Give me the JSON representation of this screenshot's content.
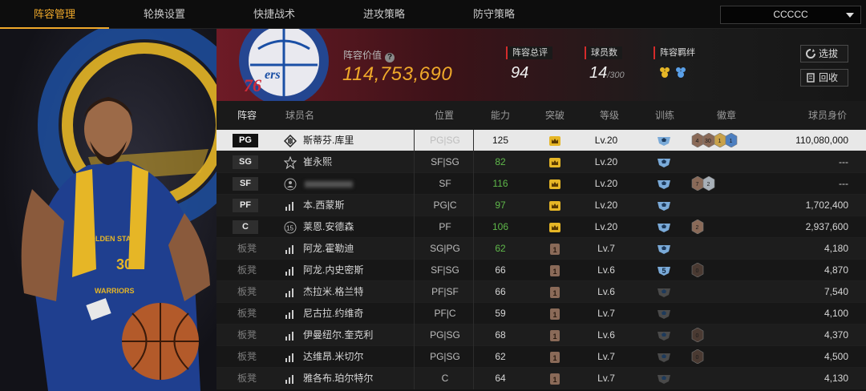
{
  "nav": {
    "tabs": [
      "阵容管理",
      "轮换设置",
      "快捷战术",
      "进攻策略",
      "防守策略"
    ],
    "active_tab": 0,
    "dropdown_value": "CCCCC"
  },
  "header": {
    "team_logo_text": "PHILADELPHIA 76ers",
    "value_label": "阵容价值",
    "value": "114,753,690",
    "rating_label": "阵容总评",
    "rating": "94",
    "count_label": "球员数",
    "count": "14",
    "count_max": "/300",
    "bond_label": "阵容羁绊",
    "btn_pick": "选拔",
    "btn_recycle": "回收"
  },
  "columns": {
    "lineup": "阵容",
    "name": "球员名",
    "position": "位置",
    "ability": "能力",
    "breakthrough": "突破",
    "level": "等级",
    "training": "训练",
    "badges": "徽章",
    "value": "球员身价"
  },
  "rows": [
    {
      "slot": "PG",
      "starter": true,
      "name": "斯蒂芬.库里",
      "pos": "PG|SG",
      "ability": "125",
      "ability_green": false,
      "break": "gold",
      "level": "Lv.20",
      "train": "blue",
      "train_num": "",
      "badges": [
        [
          "4",
          "bronze"
        ],
        [
          "30",
          "bronze"
        ],
        [
          "1",
          "gold"
        ],
        [
          "1",
          "blue"
        ]
      ],
      "value": "110,080,000",
      "pos_icon": "diamond"
    },
    {
      "slot": "SG",
      "starter": true,
      "name": "崔永熙",
      "pos": "SF|SG",
      "ability": "82",
      "ability_green": true,
      "break": "gold",
      "level": "Lv.20",
      "train": "blue",
      "train_num": "",
      "badges": [],
      "value": "---",
      "pos_icon": "star"
    },
    {
      "slot": "SF",
      "starter": true,
      "name": "",
      "pos": "SF",
      "ability": "116",
      "ability_green": true,
      "break": "gold",
      "level": "Lv.20",
      "train": "blue",
      "train_num": "",
      "badges": [
        [
          "7",
          "bronze"
        ],
        [
          "2",
          "silver"
        ]
      ],
      "value": "---",
      "pos_icon": "person"
    },
    {
      "slot": "PF",
      "starter": true,
      "name": "本.西蒙斯",
      "pos": "PG|C",
      "ability": "97",
      "ability_green": true,
      "break": "gold",
      "level": "Lv.20",
      "train": "blue",
      "train_num": "",
      "badges": [],
      "value": "1,702,400",
      "pos_icon": "bars"
    },
    {
      "slot": "C",
      "starter": true,
      "name": "莱恩.安德森",
      "pos": "PF",
      "ability": "106",
      "ability_green": true,
      "break": "gold",
      "level": "Lv.20",
      "train": "blue",
      "train_num": "",
      "badges": [
        [
          "2",
          "bronze"
        ]
      ],
      "value": "2,937,600",
      "pos_icon": "15"
    },
    {
      "slot": "板凳",
      "starter": false,
      "name": "阿龙.霍勒迪",
      "pos": "SG|PG",
      "ability": "62",
      "ability_green": true,
      "break": "1",
      "level": "Lv.7",
      "train": "blue",
      "train_num": "",
      "badges": [],
      "value": "4,180",
      "pos_icon": "bars"
    },
    {
      "slot": "板凳",
      "starter": false,
      "name": "阿龙.内史密斯",
      "pos": "SF|SG",
      "ability": "66",
      "ability_green": false,
      "break": "1",
      "level": "Lv.6",
      "train": "blue",
      "train_num": "5",
      "badges": [
        [
          "0",
          "dark"
        ]
      ],
      "value": "4,870",
      "pos_icon": "bars"
    },
    {
      "slot": "板凳",
      "starter": false,
      "name": "杰拉米.格兰特",
      "pos": "PF|SF",
      "ability": "66",
      "ability_green": false,
      "break": "1",
      "level": "Lv.6",
      "train": "dark",
      "train_num": "",
      "badges": [],
      "value": "7,540",
      "pos_icon": "bars"
    },
    {
      "slot": "板凳",
      "starter": false,
      "name": "尼古拉.约维奇",
      "pos": "PF|C",
      "ability": "59",
      "ability_green": false,
      "break": "1",
      "level": "Lv.7",
      "train": "dark",
      "train_num": "",
      "badges": [],
      "value": "4,100",
      "pos_icon": "bars"
    },
    {
      "slot": "板凳",
      "starter": false,
      "name": "伊曼纽尔.奎克利",
      "pos": "PG|SG",
      "ability": "68",
      "ability_green": false,
      "break": "1",
      "level": "Lv.6",
      "train": "dark",
      "train_num": "",
      "badges": [
        [
          "0",
          "dark"
        ]
      ],
      "value": "4,370",
      "pos_icon": "bars"
    },
    {
      "slot": "板凳",
      "starter": false,
      "name": "达维昂.米切尔",
      "pos": "PG|SG",
      "ability": "62",
      "ability_green": false,
      "break": "1",
      "level": "Lv.7",
      "train": "dark",
      "train_num": "",
      "badges": [
        [
          "0",
          "dark"
        ]
      ],
      "value": "4,500",
      "pos_icon": "bars"
    },
    {
      "slot": "板凳",
      "starter": false,
      "name": "雅各布.珀尔特尔",
      "pos": "C",
      "ability": "64",
      "ability_green": false,
      "break": "1",
      "level": "Lv.7",
      "train": "dark",
      "train_num": "",
      "badges": [],
      "value": "4,130",
      "pos_icon": "bars"
    }
  ],
  "player_art": {
    "jersey_team": "GOLDEN STATE",
    "jersey_number": "30",
    "jersey_label": "WARRIORS"
  },
  "colors": {
    "accent": "#f0a92a",
    "green": "#5fb84a",
    "selected_row": "#e8e8e8"
  }
}
